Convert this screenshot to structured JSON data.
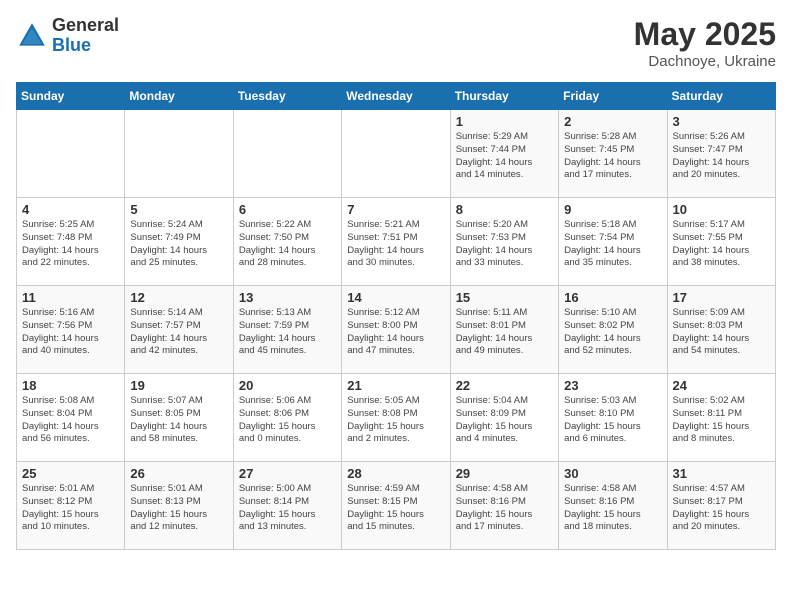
{
  "logo": {
    "general": "General",
    "blue": "Blue"
  },
  "title": {
    "month_year": "May 2025",
    "location": "Dachnoye, Ukraine"
  },
  "days_of_week": [
    "Sunday",
    "Monday",
    "Tuesday",
    "Wednesday",
    "Thursday",
    "Friday",
    "Saturday"
  ],
  "weeks": [
    [
      {
        "day": "",
        "info": ""
      },
      {
        "day": "",
        "info": ""
      },
      {
        "day": "",
        "info": ""
      },
      {
        "day": "",
        "info": ""
      },
      {
        "day": "1",
        "info": "Sunrise: 5:29 AM\nSunset: 7:44 PM\nDaylight: 14 hours\nand 14 minutes."
      },
      {
        "day": "2",
        "info": "Sunrise: 5:28 AM\nSunset: 7:45 PM\nDaylight: 14 hours\nand 17 minutes."
      },
      {
        "day": "3",
        "info": "Sunrise: 5:26 AM\nSunset: 7:47 PM\nDaylight: 14 hours\nand 20 minutes."
      }
    ],
    [
      {
        "day": "4",
        "info": "Sunrise: 5:25 AM\nSunset: 7:48 PM\nDaylight: 14 hours\nand 22 minutes."
      },
      {
        "day": "5",
        "info": "Sunrise: 5:24 AM\nSunset: 7:49 PM\nDaylight: 14 hours\nand 25 minutes."
      },
      {
        "day": "6",
        "info": "Sunrise: 5:22 AM\nSunset: 7:50 PM\nDaylight: 14 hours\nand 28 minutes."
      },
      {
        "day": "7",
        "info": "Sunrise: 5:21 AM\nSunset: 7:51 PM\nDaylight: 14 hours\nand 30 minutes."
      },
      {
        "day": "8",
        "info": "Sunrise: 5:20 AM\nSunset: 7:53 PM\nDaylight: 14 hours\nand 33 minutes."
      },
      {
        "day": "9",
        "info": "Sunrise: 5:18 AM\nSunset: 7:54 PM\nDaylight: 14 hours\nand 35 minutes."
      },
      {
        "day": "10",
        "info": "Sunrise: 5:17 AM\nSunset: 7:55 PM\nDaylight: 14 hours\nand 38 minutes."
      }
    ],
    [
      {
        "day": "11",
        "info": "Sunrise: 5:16 AM\nSunset: 7:56 PM\nDaylight: 14 hours\nand 40 minutes."
      },
      {
        "day": "12",
        "info": "Sunrise: 5:14 AM\nSunset: 7:57 PM\nDaylight: 14 hours\nand 42 minutes."
      },
      {
        "day": "13",
        "info": "Sunrise: 5:13 AM\nSunset: 7:59 PM\nDaylight: 14 hours\nand 45 minutes."
      },
      {
        "day": "14",
        "info": "Sunrise: 5:12 AM\nSunset: 8:00 PM\nDaylight: 14 hours\nand 47 minutes."
      },
      {
        "day": "15",
        "info": "Sunrise: 5:11 AM\nSunset: 8:01 PM\nDaylight: 14 hours\nand 49 minutes."
      },
      {
        "day": "16",
        "info": "Sunrise: 5:10 AM\nSunset: 8:02 PM\nDaylight: 14 hours\nand 52 minutes."
      },
      {
        "day": "17",
        "info": "Sunrise: 5:09 AM\nSunset: 8:03 PM\nDaylight: 14 hours\nand 54 minutes."
      }
    ],
    [
      {
        "day": "18",
        "info": "Sunrise: 5:08 AM\nSunset: 8:04 PM\nDaylight: 14 hours\nand 56 minutes."
      },
      {
        "day": "19",
        "info": "Sunrise: 5:07 AM\nSunset: 8:05 PM\nDaylight: 14 hours\nand 58 minutes."
      },
      {
        "day": "20",
        "info": "Sunrise: 5:06 AM\nSunset: 8:06 PM\nDaylight: 15 hours\nand 0 minutes."
      },
      {
        "day": "21",
        "info": "Sunrise: 5:05 AM\nSunset: 8:08 PM\nDaylight: 15 hours\nand 2 minutes."
      },
      {
        "day": "22",
        "info": "Sunrise: 5:04 AM\nSunset: 8:09 PM\nDaylight: 15 hours\nand 4 minutes."
      },
      {
        "day": "23",
        "info": "Sunrise: 5:03 AM\nSunset: 8:10 PM\nDaylight: 15 hours\nand 6 minutes."
      },
      {
        "day": "24",
        "info": "Sunrise: 5:02 AM\nSunset: 8:11 PM\nDaylight: 15 hours\nand 8 minutes."
      }
    ],
    [
      {
        "day": "25",
        "info": "Sunrise: 5:01 AM\nSunset: 8:12 PM\nDaylight: 15 hours\nand 10 minutes."
      },
      {
        "day": "26",
        "info": "Sunrise: 5:01 AM\nSunset: 8:13 PM\nDaylight: 15 hours\nand 12 minutes."
      },
      {
        "day": "27",
        "info": "Sunrise: 5:00 AM\nSunset: 8:14 PM\nDaylight: 15 hours\nand 13 minutes."
      },
      {
        "day": "28",
        "info": "Sunrise: 4:59 AM\nSunset: 8:15 PM\nDaylight: 15 hours\nand 15 minutes."
      },
      {
        "day": "29",
        "info": "Sunrise: 4:58 AM\nSunset: 8:16 PM\nDaylight: 15 hours\nand 17 minutes."
      },
      {
        "day": "30",
        "info": "Sunrise: 4:58 AM\nSunset: 8:16 PM\nDaylight: 15 hours\nand 18 minutes."
      },
      {
        "day": "31",
        "info": "Sunrise: 4:57 AM\nSunset: 8:17 PM\nDaylight: 15 hours\nand 20 minutes."
      }
    ]
  ]
}
